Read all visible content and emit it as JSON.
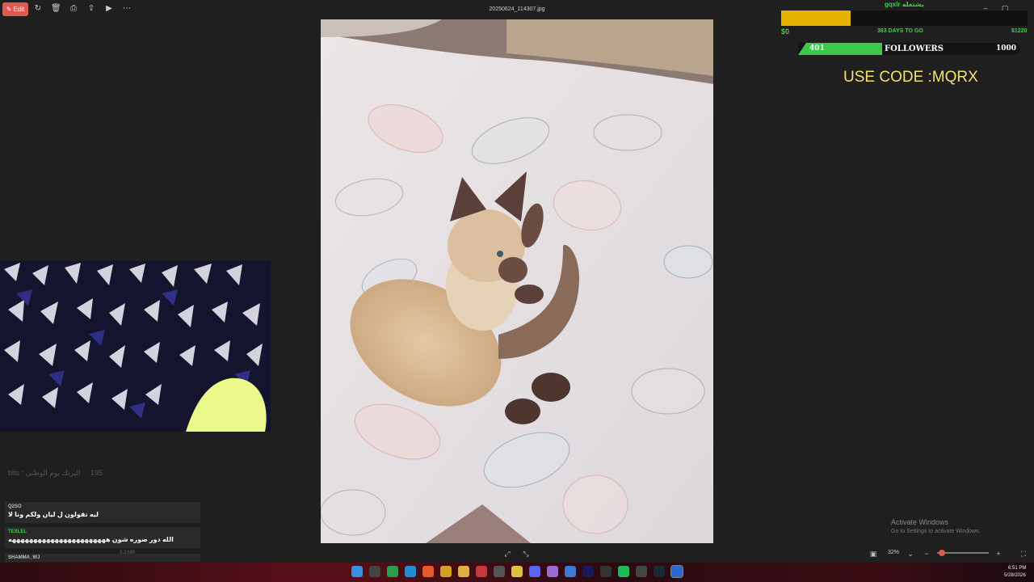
{
  "viewer": {
    "edit_label": "Edit",
    "file_name": "20250624_114307.jpg",
    "zoom": "32%",
    "zoom_level": 0.05,
    "activate_title": "Activate Windows",
    "activate_sub": "Go to Settings to activate Windows."
  },
  "overlay": {
    "top_text": "gqxlr يشتغله",
    "goal_amount": "$0",
    "goal_days": "363 DAYS TO GO",
    "goal_target": "$1220",
    "goal_progress": 0.28,
    "followers_current": "401",
    "followers_label": "FOLLOWERS",
    "followers_goal": "1000",
    "code_text": "USE CODE :MQRX"
  },
  "chat": {
    "faded_line": "bits : البرتك يوم الوطني",
    "faded_count": "195",
    "messages": [
      {
        "user": "Q2SO",
        "text": "ليه تقولون ل ليان ولكم ونا لا",
        "color": "#bfbfbf"
      },
      {
        "user": "TEXLEL",
        "text": "الله دور صوره شون هههههههههههههههههههههههه",
        "color": "#3fc74a"
      }
    ],
    "meta_line": "3.2 MB",
    "last_user": "SHAMMA_WJ"
  },
  "taskbar": {
    "time": "6:51 PM",
    "date": "5/28/2026"
  },
  "colors": {
    "accent": "#e05a4f",
    "goal_fill": "#e4b400",
    "followers_fill": "#3fc74a",
    "code_yellow": "#f1e36a"
  }
}
